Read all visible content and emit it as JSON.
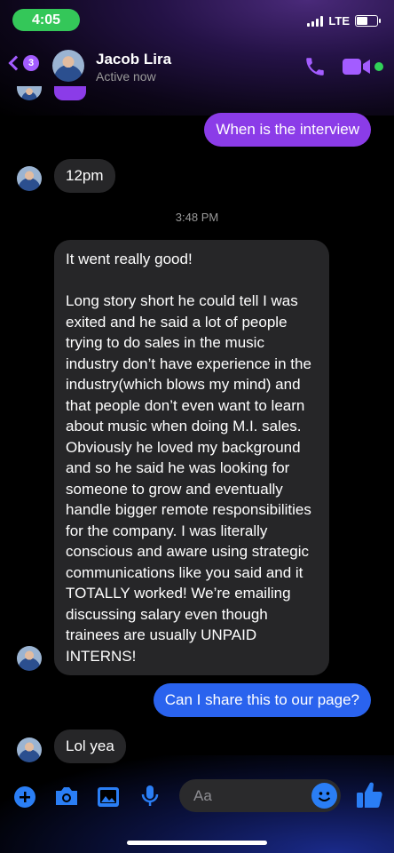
{
  "status_bar": {
    "time": "4:05",
    "network": "LTE",
    "battery_level": 0.55
  },
  "header": {
    "back_count": "3",
    "contact_name": "Jacob Lira",
    "status": "Active now"
  },
  "messages": [
    {
      "type": "outgoing",
      "text": "When is the interview"
    },
    {
      "type": "incoming",
      "text": "12pm"
    },
    {
      "type": "timestamp",
      "text": "3:48 PM"
    },
    {
      "type": "incoming",
      "text": "It went really good!\n\nLong story short he could tell I was exited and he said a lot of people trying to do sales in the music industry don’t have experience in the industry(which blows my mind) and that people don’t even want to learn about music when doing M.I. sales. Obviously he loved my background and so he said he was looking for someone to grow and eventually handle bigger remote responsibilities for the company. I was literally conscious and aware using strategic communications like you said and it TOTALLY worked! We’re emailing discussing salary even though trainees are usually UNPAID INTERNS!"
    },
    {
      "type": "outgoing",
      "text": "Can I share this to our page?"
    },
    {
      "type": "incoming",
      "text": "Lol yea"
    }
  ],
  "composer": {
    "placeholder": "Aa"
  },
  "colors": {
    "accent_purple": "#a35cff",
    "outgoing_purple": "#8b3ce8",
    "outgoing_blue": "#2a63ee",
    "composer_blue": "#2a7ef5",
    "incoming_gray": "#262628",
    "online_green": "#31d158"
  },
  "icons": [
    "back-chevron-icon",
    "phone-icon",
    "video-camera-icon",
    "plus-icon",
    "camera-icon",
    "image-icon",
    "microphone-icon",
    "emoji-icon",
    "thumbs-up-icon"
  ]
}
